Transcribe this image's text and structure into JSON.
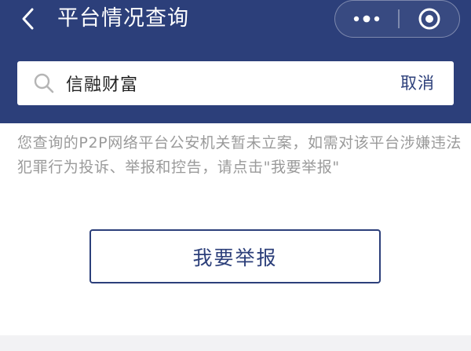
{
  "header": {
    "title": "平台情况查询",
    "back_icon": "chevron-left-icon",
    "capsule": {
      "more_icon": "more-dots-icon",
      "close_icon": "close-target-icon"
    },
    "background_color": "#2c3f7a"
  },
  "search": {
    "icon": "search-icon",
    "value": "信融财富",
    "cancel_label": "取消"
  },
  "notice": {
    "text": "您查询的P2P网络平台公安机关暂未立案，如需对该平台涉嫌违法犯罪行为投诉、举报和控告，请点击\"我要举报\""
  },
  "actions": {
    "report_label": "我要举报"
  }
}
